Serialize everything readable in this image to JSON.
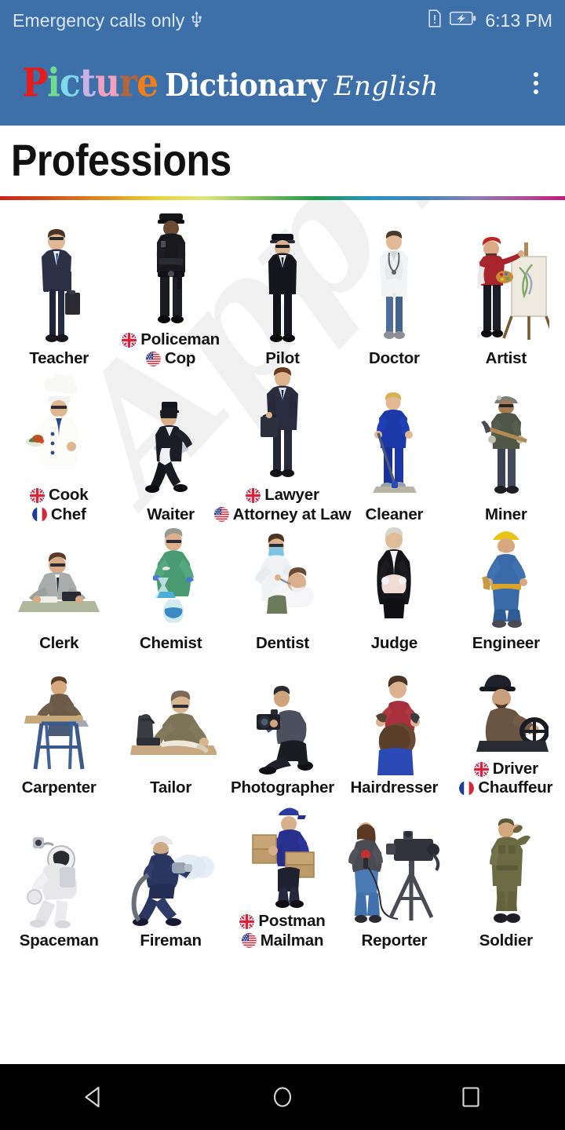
{
  "status_bar": {
    "carrier": "Emergency calls only",
    "usb_icon": "usb-icon",
    "sim_icon": "sim-warning-icon",
    "battery_icon": "battery-charging-icon",
    "time": "6:13 PM",
    "background": "#3d6fa8"
  },
  "app_bar": {
    "logo_picture": "Picture",
    "logo_picture_letters": [
      {
        "ch": "P",
        "color": "#e81b1b"
      },
      {
        "ch": "i",
        "color": "#6edb8f"
      },
      {
        "ch": "c",
        "color": "#7fd9e8"
      },
      {
        "ch": "t",
        "color": "#c9b3e6"
      },
      {
        "ch": "u",
        "color": "#f2a0bd"
      },
      {
        "ch": "r",
        "color": "#b5653a"
      },
      {
        "ch": "e",
        "color": "#ef7d18"
      }
    ],
    "logo_dictionary": "Dictionary",
    "logo_english": "English",
    "overflow_menu": "more-options",
    "background": "#3d6fa8"
  },
  "page": {
    "title": "Professions",
    "watermark": "App Familly",
    "divider": "rainbow-gradient-rule"
  },
  "grid": {
    "rows": [
      [
        {
          "name": "Teacher",
          "art": "teacher",
          "labels": [
            {
              "text": "Teacher",
              "flag": null
            }
          ]
        },
        {
          "name": "Policeman",
          "art": "policeman",
          "labels": [
            {
              "text": "Policeman",
              "flag": "uk"
            },
            {
              "text": "Cop",
              "flag": "us"
            }
          ]
        },
        {
          "name": "Pilot",
          "art": "pilot",
          "labels": [
            {
              "text": "Pilot",
              "flag": null
            }
          ]
        },
        {
          "name": "Doctor",
          "art": "doctor",
          "labels": [
            {
              "text": "Doctor",
              "flag": null
            }
          ]
        },
        {
          "name": "Artist",
          "art": "artist",
          "labels": [
            {
              "text": "Artist",
              "flag": null
            }
          ]
        }
      ],
      [
        {
          "name": "Cook",
          "art": "cook",
          "labels": [
            {
              "text": "Cook",
              "flag": "uk"
            },
            {
              "text": "Chef",
              "flag": "fr"
            }
          ]
        },
        {
          "name": "Waiter",
          "art": "waiter",
          "labels": [
            {
              "text": "Waiter",
              "flag": null
            }
          ]
        },
        {
          "name": "Lawyer",
          "art": "lawyer",
          "labels": [
            {
              "text": "Lawyer",
              "flag": "uk"
            },
            {
              "text": "Attorney at Law",
              "flag": "us"
            }
          ]
        },
        {
          "name": "Cleaner",
          "art": "cleaner",
          "labels": [
            {
              "text": "Cleaner",
              "flag": null
            }
          ]
        },
        {
          "name": "Miner",
          "art": "miner",
          "labels": [
            {
              "text": "Miner",
              "flag": null
            }
          ]
        }
      ],
      [
        {
          "name": "Clerk",
          "art": "clerk",
          "labels": [
            {
              "text": "Clerk",
              "flag": null
            }
          ]
        },
        {
          "name": "Chemist",
          "art": "chemist",
          "labels": [
            {
              "text": "Chemist",
              "flag": null
            }
          ]
        },
        {
          "name": "Dentist",
          "art": "dentist",
          "labels": [
            {
              "text": "Dentist",
              "flag": null
            }
          ]
        },
        {
          "name": "Judge",
          "art": "judge",
          "labels": [
            {
              "text": "Judge",
              "flag": null
            }
          ]
        },
        {
          "name": "Engineer",
          "art": "engineer",
          "labels": [
            {
              "text": "Engineer",
              "flag": null
            }
          ]
        }
      ],
      [
        {
          "name": "Carpenter",
          "art": "carpenter",
          "labels": [
            {
              "text": "Carpenter",
              "flag": null
            }
          ]
        },
        {
          "name": "Tailor",
          "art": "tailor",
          "labels": [
            {
              "text": "Tailor",
              "flag": null
            }
          ]
        },
        {
          "name": "Photographer",
          "art": "photographer",
          "labels": [
            {
              "text": "Photographer",
              "flag": null
            }
          ]
        },
        {
          "name": "Hairdresser",
          "art": "hairdresser",
          "labels": [
            {
              "text": "Hairdresser",
              "flag": null
            }
          ]
        },
        {
          "name": "Driver",
          "art": "driver",
          "labels": [
            {
              "text": "Driver",
              "flag": "uk"
            },
            {
              "text": "Chauffeur",
              "flag": "fr"
            }
          ]
        }
      ],
      [
        {
          "name": "Spaceman",
          "art": "spaceman",
          "labels": [
            {
              "text": "Spaceman",
              "flag": null
            }
          ]
        },
        {
          "name": "Fireman",
          "art": "fireman",
          "labels": [
            {
              "text": "Fireman",
              "flag": null
            }
          ]
        },
        {
          "name": "Postman",
          "art": "postman",
          "labels": [
            {
              "text": "Postman",
              "flag": "uk"
            },
            {
              "text": "Mailman",
              "flag": "us"
            }
          ]
        },
        {
          "name": "Reporter",
          "art": "reporter",
          "labels": [
            {
              "text": "Reporter",
              "flag": null
            }
          ]
        },
        {
          "name": "Soldier",
          "art": "soldier",
          "labels": [
            {
              "text": "Soldier",
              "flag": null
            }
          ]
        }
      ]
    ]
  },
  "nav_bar": {
    "back": "back-triangle-icon",
    "home": "home-circle-icon",
    "recents": "recents-square-icon",
    "background": "#000000"
  }
}
